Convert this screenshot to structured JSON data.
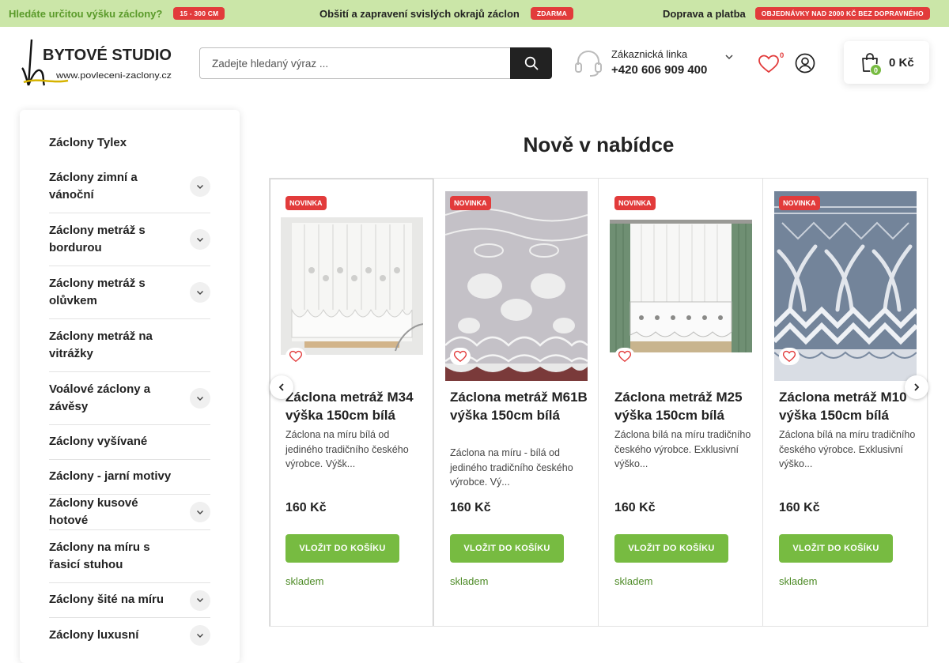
{
  "topbar": {
    "item1_text": "Hledáte určitou výšku záclony?",
    "item1_badge": "15 - 300 CM",
    "item2_text": "Obšití a zapravení svislých okrajů záclon",
    "item2_badge": "ZDARMA",
    "item3_text": "Doprava a platba",
    "item3_badge": "OBJEDNÁVKY NAD 2000 KČ BEZ DOPRAVNÉHO"
  },
  "logo": {
    "name": "BYTOVÉ STUDIO",
    "url": "www.povleceni-zaclony.cz"
  },
  "search": {
    "placeholder": "Zadejte hledaný výraz ...",
    "value": ""
  },
  "contact": {
    "label": "Zákaznická linka",
    "phone": "+420 606 909 400"
  },
  "favorites": {
    "count": "0"
  },
  "cart": {
    "count": "0",
    "total": "0 Kč"
  },
  "sidebar": {
    "items": [
      {
        "label": "Záclony Tylex",
        "expandable": false
      },
      {
        "label": "Záclony zimní a vánoční",
        "expandable": true
      },
      {
        "label": "Záclony metráž s bordurou",
        "expandable": true
      },
      {
        "label": "Záclony metráž s olůvkem",
        "expandable": true
      },
      {
        "label": "Záclony metráž na vitrážky",
        "expandable": false
      },
      {
        "label": "Voálové záclony a závěsy",
        "expandable": true
      },
      {
        "label": "Záclony vyšívané",
        "expandable": false
      },
      {
        "label": "Záclony - jarní motivy",
        "expandable": false
      },
      {
        "label": "Záclony kusové hotové",
        "expandable": true
      },
      {
        "label": "Záclony na míru s řasicí stuhou",
        "expandable": false
      },
      {
        "label": "Záclony šité na míru",
        "expandable": true
      },
      {
        "label": "Záclony luxusní",
        "expandable": true
      }
    ]
  },
  "section": {
    "title": "Nově v nabídce"
  },
  "products": [
    {
      "badge": "NOVINKA",
      "name": "Záclona metráž M34 výška 150cm bílá",
      "desc": "Záclona na míru bílá od jediného tradičního českého výrobce. Výšk...",
      "price": "160 Kč",
      "button": "VLOŽIT DO KOŠÍKU",
      "stock": "skladem"
    },
    {
      "badge": "NOVINKA",
      "name": "Záclona metráž M61B výška 150cm bílá",
      "desc": "Záclona na míru - bílá od jediného tradičního českého výrobce. Vý...",
      "price": "160 Kč",
      "button": "VLOŽIT DO KOŠÍKU",
      "stock": "skladem"
    },
    {
      "badge": "NOVINKA",
      "name": "Záclona metráž M25 výška 150cm bílá",
      "desc": "Záclona bílá na míru tradičního českého výrobce. Exklusivní výško...",
      "price": "160 Kč",
      "button": "VLOŽIT DO KOŠÍKU",
      "stock": "skladem"
    },
    {
      "badge": "NOVINKA",
      "name": "Záclona metráž M10 výška 150cm bílá",
      "desc": "Záclona bílá na míru tradičního českého výrobce. Exklusivní výško...",
      "price": "160 Kč",
      "button": "VLOŽIT DO KOŠÍKU",
      "stock": "skladem"
    }
  ],
  "icons": {
    "search": "search-icon",
    "phone": "headset-icon",
    "chevron": "chevron-down-icon",
    "favorite": "heart-icon",
    "user": "user-icon",
    "cart": "shopping-bag-icon",
    "prev": "chevron-left-icon",
    "next": "chevron-right-icon"
  },
  "colors": {
    "accent_green": "#77bb41",
    "topbar_bg": "#cbe6a8",
    "badge_red": "#e23b3b",
    "stock_green": "#4c8a25"
  }
}
